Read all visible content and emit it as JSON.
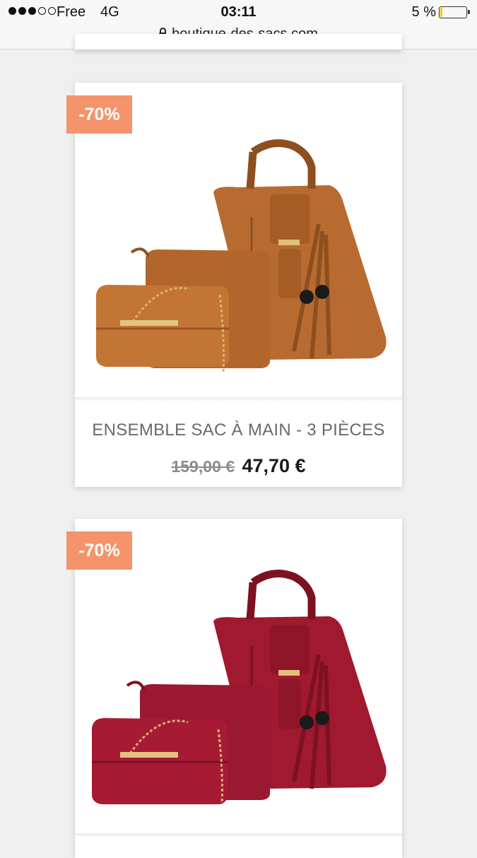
{
  "status_bar": {
    "carrier": "Free",
    "network": "4G",
    "time": "03:11",
    "battery_percent": "5 %",
    "battery_level": 0.05
  },
  "url_bar": {
    "url": "boutique-des-sacs.com"
  },
  "products": [
    {
      "badge": "-70%",
      "title": "ENSEMBLE SAC À MAIN - 3 PIÈCES",
      "old_price": "159,00 €",
      "new_price": "47,70 €",
      "image_color": "#b86b30"
    },
    {
      "badge": "-70%",
      "image_color": "#a0192f"
    }
  ],
  "colors": {
    "badge": "#f4946b",
    "title": "#6a6a6a",
    "page_background": "#efefef"
  }
}
